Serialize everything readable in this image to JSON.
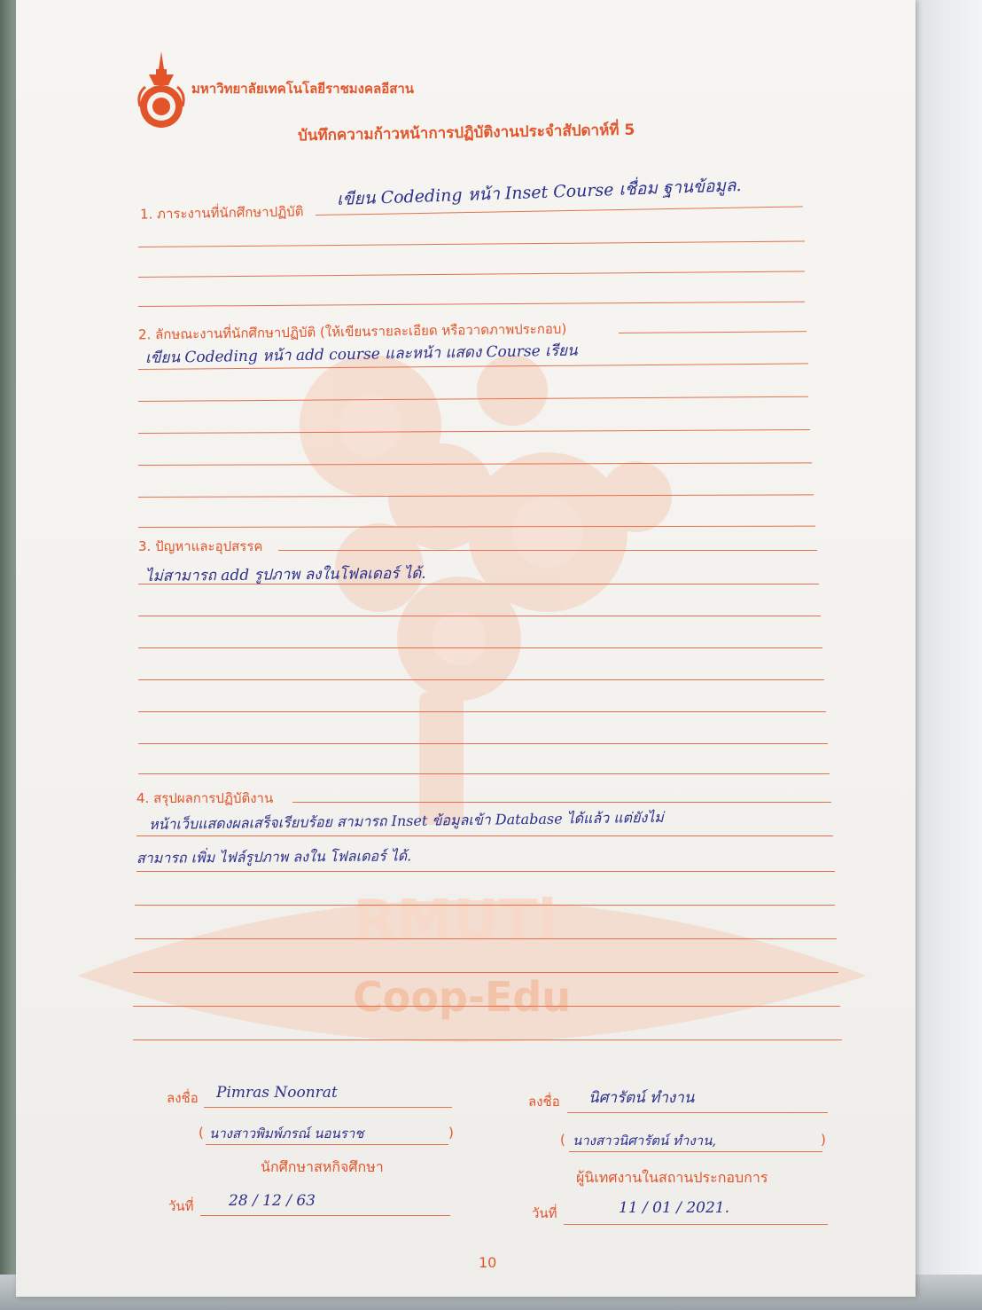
{
  "header": {
    "university": "มหาวิทยาลัยเทคโนโลยีราชมงคลอีสาน",
    "title": "บันทึกความก้าวหน้าการปฏิบัติงานประจำสัปดาห์ที่ 5"
  },
  "watermark": {
    "line1": "RMUTi",
    "line2": "Coop-Edu"
  },
  "sections": [
    {
      "label": "1. ภาระงานที่นักศึกษาปฏิบัติ",
      "entries": [
        "เขียน Codeding หน้า Inset Course เชื่อม ฐานข้อมูล."
      ]
    },
    {
      "label": "2. ลักษณะงานที่นักศึกษาปฏิบัติ (ให้เขียนรายละเอียด หรือวาดภาพประกอบ)",
      "entries": [
        "เขียน Codeding หน้า add course และหน้า แสดง Course เรียน"
      ]
    },
    {
      "label": "3. ปัญหาและอุปสรรค",
      "entries": [
        "ไม่สามารถ add รูปภาพ ลงในโฟลเดอร์ ได้."
      ]
    },
    {
      "label": "4. สรุปผลการปฏิบัติงาน",
      "entries": [
        "หน้าเว็บแสดงผลเสร็จเรียบร้อย สามารถ Inset ข้อมูลเข้า Database ได้แล้ว แต่ยังไม่",
        "สามารถ เพิ่ม ไฟล์รูปภาพ ลงใน โฟลเดอร์ ได้."
      ]
    }
  ],
  "signatures": {
    "left": {
      "sign_label": "ลงชื่อ",
      "signature": "Pimras Noonrat",
      "name": "นางสาวพิมพ์ภรณ์ นอนราช",
      "open_paren": "(",
      "close_paren": ")",
      "role": "นักศึกษาสหกิจศึกษา",
      "date_label": "วันที่",
      "date": "28 / 12 / 63"
    },
    "right": {
      "sign_label": "ลงชื่อ",
      "signature": "นิศารัตน์ ทำงาน",
      "name": "นางสาวนิศารัตน์ ทำงาน,",
      "open_paren": "(",
      "close_paren": ")",
      "role": "ผู้นิเทศงานในสถานประกอบการ",
      "date_label": "วันที่",
      "date": "11 / 01 / 2021."
    }
  },
  "page_number": "10",
  "colors": {
    "print": "#e2552a",
    "ink": "#2c2f8c",
    "paper": "#f5f3ef"
  }
}
